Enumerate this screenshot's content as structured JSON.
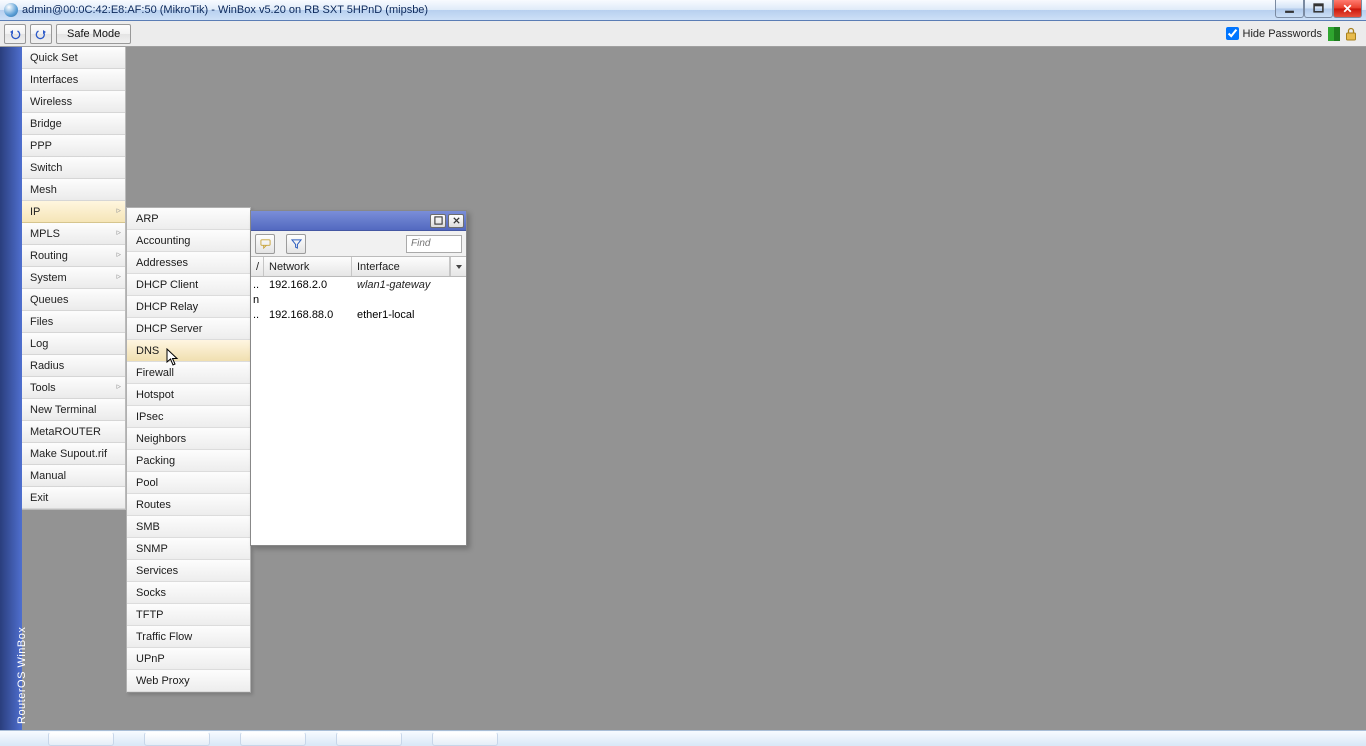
{
  "title": "admin@00:0C:42:E8:AF:50 (MikroTik) - WinBox v5.20 on RB SXT 5HPnD (mipsbe)",
  "toolbar": {
    "safe_mode": "Safe Mode",
    "hide_passwords": "Hide Passwords"
  },
  "side_label": "RouterOS WinBox",
  "main_menu": {
    "items": [
      {
        "label": "Quick Set",
        "sub": false
      },
      {
        "label": "Interfaces",
        "sub": false
      },
      {
        "label": "Wireless",
        "sub": false
      },
      {
        "label": "Bridge",
        "sub": false
      },
      {
        "label": "PPP",
        "sub": false
      },
      {
        "label": "Switch",
        "sub": false
      },
      {
        "label": "Mesh",
        "sub": false
      },
      {
        "label": "IP",
        "sub": true,
        "active": true
      },
      {
        "label": "MPLS",
        "sub": true
      },
      {
        "label": "Routing",
        "sub": true
      },
      {
        "label": "System",
        "sub": true
      },
      {
        "label": "Queues",
        "sub": false
      },
      {
        "label": "Files",
        "sub": false
      },
      {
        "label": "Log",
        "sub": false
      },
      {
        "label": "Radius",
        "sub": false
      },
      {
        "label": "Tools",
        "sub": true
      },
      {
        "label": "New Terminal",
        "sub": false
      },
      {
        "label": "MetaROUTER",
        "sub": false
      },
      {
        "label": "Make Supout.rif",
        "sub": false
      },
      {
        "label": "Manual",
        "sub": false
      },
      {
        "label": "Exit",
        "sub": false
      }
    ]
  },
  "ip_submenu": {
    "items": [
      "ARP",
      "Accounting",
      "Addresses",
      "DHCP Client",
      "DHCP Relay",
      "DHCP Server",
      "DNS",
      "Firewall",
      "Hotspot",
      "IPsec",
      "Neighbors",
      "Packing",
      "Pool",
      "Routes",
      "SMB",
      "SNMP",
      "Services",
      "Socks",
      "TFTP",
      "Traffic Flow",
      "UPnP",
      "Web Proxy"
    ],
    "hover": "DNS"
  },
  "address_list": {
    "find_placeholder": "Find",
    "headers": {
      "network": "Network",
      "interface": "Interface"
    },
    "rows": [
      {
        "addr": "..",
        "network": "192.168.2.0",
        "interface": "wlan1-gateway",
        "italic": true
      },
      {
        "addr": "n",
        "network": "",
        "interface": ""
      },
      {
        "addr": "..",
        "network": "192.168.88.0",
        "interface": "ether1-local",
        "italic": false
      }
    ]
  }
}
